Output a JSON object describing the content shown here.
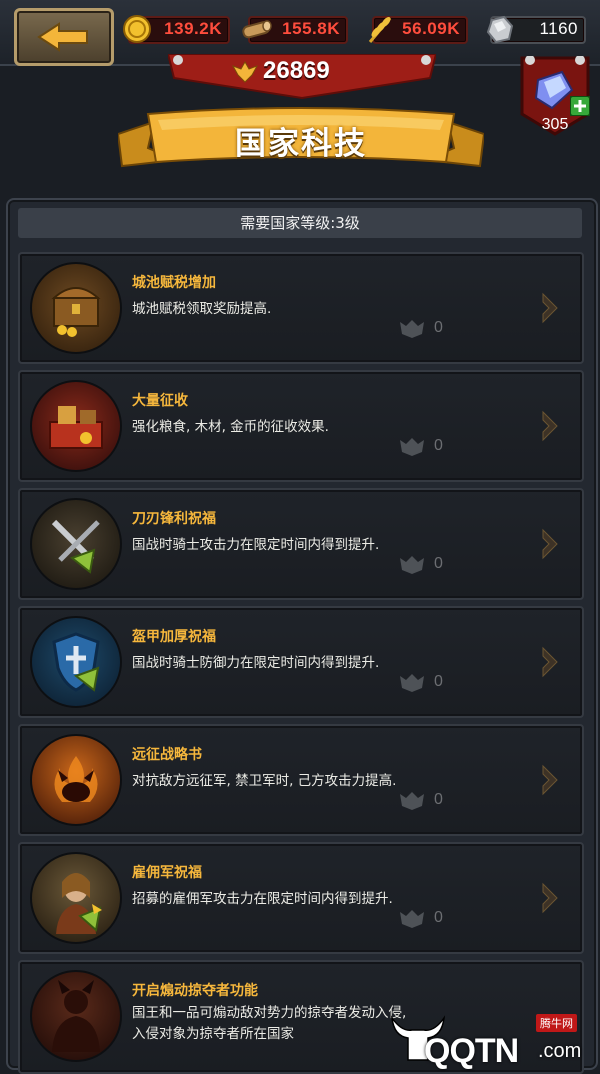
{
  "header": {
    "gold": "139.2K",
    "wood": "155.8K",
    "food": "56.09K",
    "stone": "1160"
  },
  "power": "26869",
  "gems": "305",
  "title": "国家科技",
  "requirement": "需要国家等级:3级",
  "techs": [
    {
      "title": "城池赋税增加",
      "desc": "城池赋税领取奖励提高.",
      "level": "0",
      "icon": "treasure-chest-icon"
    },
    {
      "title": "大量征收",
      "desc": "强化粮食, 木材, 金币的征收效果.",
      "level": "0",
      "icon": "resources-icon"
    },
    {
      "title": "刀刃锋利祝福",
      "desc": "国战时骑士攻击力在限定时间内得到提升.",
      "level": "0",
      "icon": "sword-icon"
    },
    {
      "title": "盔甲加厚祝福",
      "desc": "国战时骑士防御力在限定时间内得到提升.",
      "level": "0",
      "icon": "shield-icon"
    },
    {
      "title": "远征战略书",
      "desc": "对抗敌方远征军, 禁卫军时, 己方攻击力提高.",
      "level": "0",
      "icon": "flame-demon-icon"
    },
    {
      "title": "雇佣军祝福",
      "desc": "招募的雇佣军攻击力在限定时间内得到提升.",
      "level": "0",
      "icon": "mercenary-icon"
    },
    {
      "title": "开启煽动掠夺者功能",
      "desc": "国王和一品可煽动敌对势力的掠夺者发动入侵,",
      "desc2": "入侵对象为掠夺者所在国家",
      "icon": "horned-warrior-icon"
    }
  ],
  "watermark": {
    "brand": "QQTN",
    "suffix": ".com",
    "cn": "腾牛网"
  }
}
